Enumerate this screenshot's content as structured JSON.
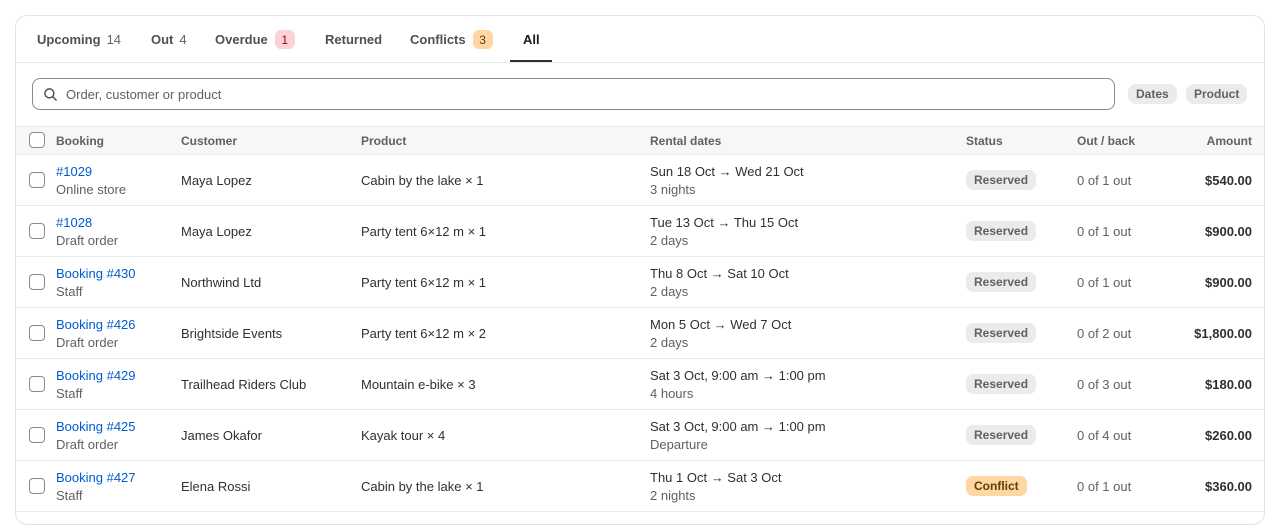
{
  "tabs": [
    {
      "label": "Upcoming",
      "count": "14",
      "badge": "",
      "badge_type": ""
    },
    {
      "label": "Out",
      "count": "4",
      "badge": "",
      "badge_type": ""
    },
    {
      "label": "Overdue",
      "count": "",
      "badge": "1",
      "badge_type": "critical"
    },
    {
      "label": "Returned",
      "count": "",
      "badge": "",
      "badge_type": ""
    },
    {
      "label": "Conflicts",
      "count": "",
      "badge": "3",
      "badge_type": "warning"
    },
    {
      "label": "All",
      "count": "",
      "badge": "",
      "badge_type": ""
    }
  ],
  "active_tab": "All",
  "search": {
    "placeholder": "Order, customer or product",
    "value": ""
  },
  "filters": [
    "Dates",
    "Product"
  ],
  "columns": {
    "booking": "Booking",
    "customer": "Customer",
    "product": "Product",
    "dates": "Rental dates",
    "status": "Status",
    "out_back": "Out / back",
    "amount": "Amount"
  },
  "rows": [
    {
      "booking": "#1029",
      "source": "Online store",
      "customer": "Maya Lopez",
      "product": "Cabin by the lake × 1",
      "dates": "Sun 18 Oct → Wed 21 Oct",
      "duration": "3 nights",
      "status": "Reserved",
      "out_back": "0 of 1 out",
      "amount": "$540.00"
    },
    {
      "booking": "#1028",
      "source": "Draft order",
      "customer": "Maya Lopez",
      "product": "Party tent 6×12 m × 1",
      "dates": "Tue 13 Oct → Thu 15 Oct",
      "duration": "2 days",
      "status": "Reserved",
      "out_back": "0 of 1 out",
      "amount": "$900.00"
    },
    {
      "booking": "Booking #430",
      "source": "Staff",
      "customer": "Northwind Ltd",
      "product": "Party tent 6×12 m × 1",
      "dates": "Thu 8 Oct → Sat 10 Oct",
      "duration": "2 days",
      "status": "Reserved",
      "out_back": "0 of 1 out",
      "amount": "$900.00"
    },
    {
      "booking": "Booking #426",
      "source": "Draft order",
      "customer": "Brightside Events",
      "product": "Party tent 6×12 m × 2",
      "dates": "Mon 5 Oct → Wed 7 Oct",
      "duration": "2 days",
      "status": "Reserved",
      "out_back": "0 of 2 out",
      "amount": "$1,800.00"
    },
    {
      "booking": "Booking #429",
      "source": "Staff",
      "customer": "Trailhead Riders Club",
      "product": "Mountain e-bike × 3",
      "dates": "Sat 3 Oct, 9:00 am → 1:00 pm",
      "duration": "4 hours",
      "status": "Reserved",
      "out_back": "0 of 3 out",
      "amount": "$180.00"
    },
    {
      "booking": "Booking #425",
      "source": "Draft order",
      "customer": "James Okafor",
      "product": "Kayak tour × 4",
      "dates": "Sat 3 Oct, 9:00 am → 1:00 pm",
      "duration": "Departure",
      "status": "Reserved",
      "out_back": "0 of 4 out",
      "amount": "$260.00"
    },
    {
      "booking": "Booking #427",
      "source": "Staff",
      "customer": "Elena Rossi",
      "product": "Cabin by the lake × 1",
      "dates": "Thu 1 Oct → Sat 3 Oct",
      "duration": "2 nights",
      "status": "Conflict",
      "out_back": "0 of 1 out",
      "amount": "$360.00"
    }
  ]
}
